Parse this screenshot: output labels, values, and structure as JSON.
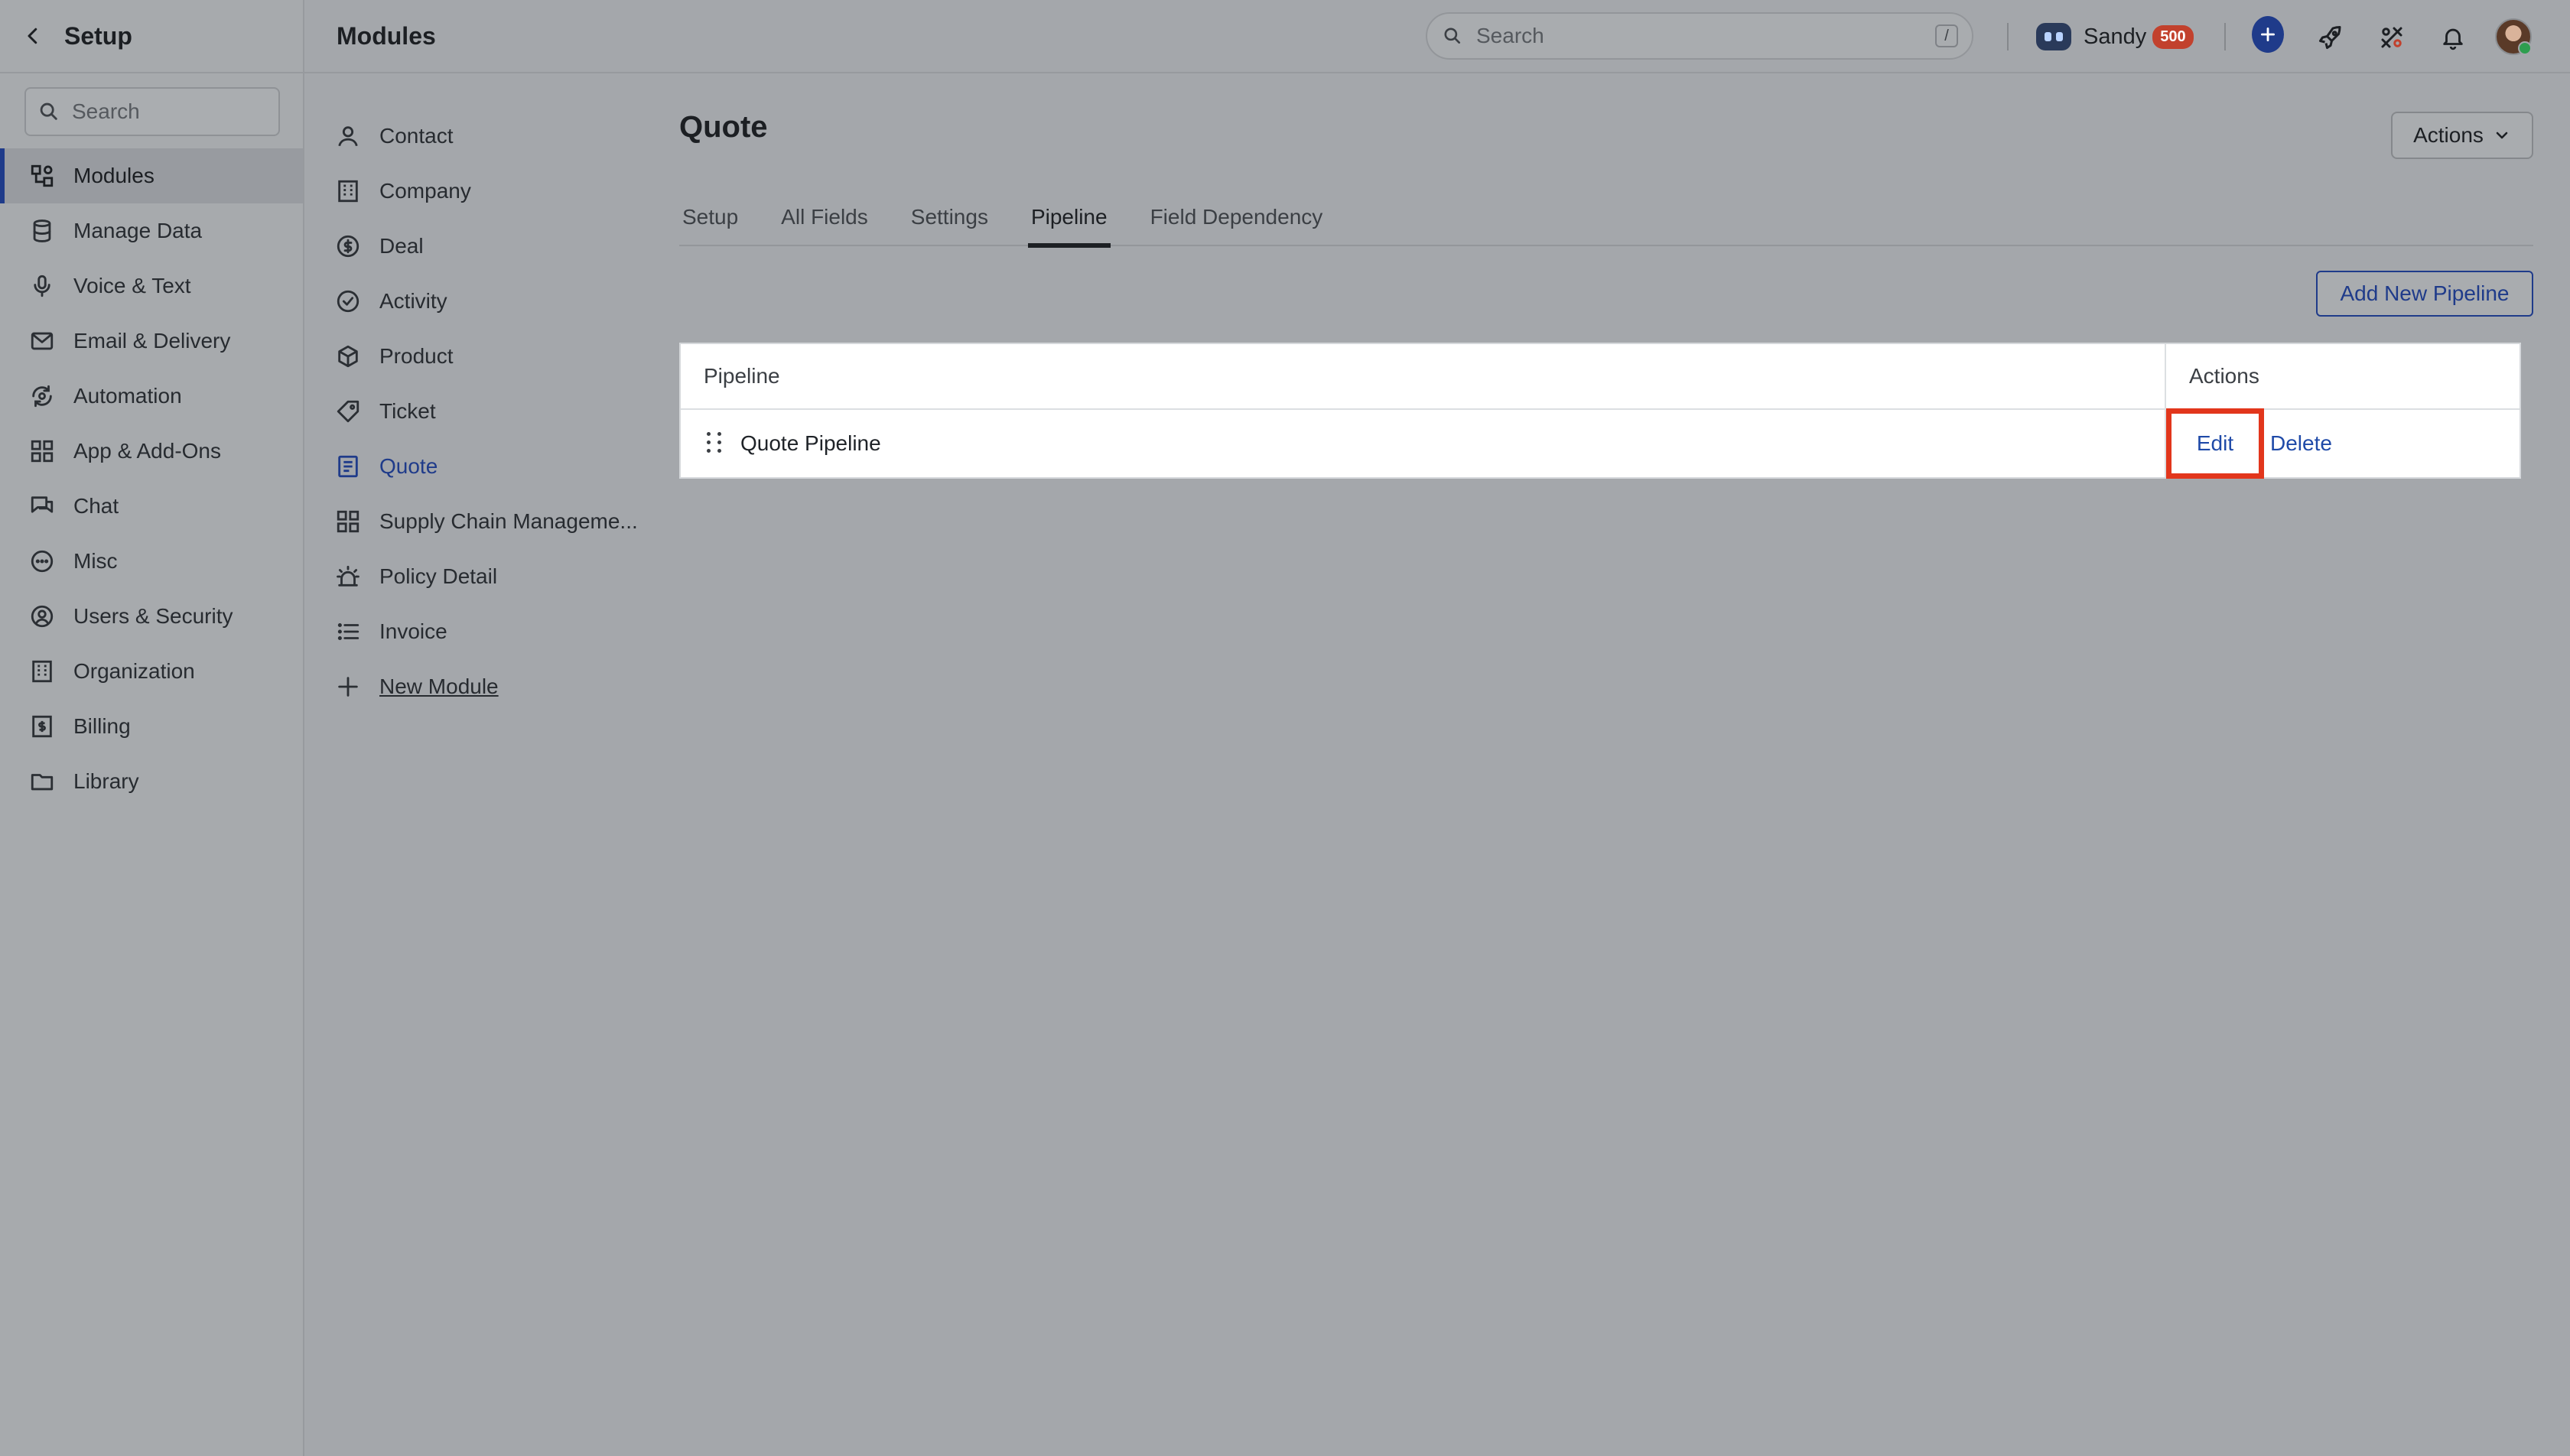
{
  "sidebar": {
    "title": "Setup",
    "search_placeholder": "Search",
    "items": [
      {
        "label": "Modules"
      },
      {
        "label": "Manage Data"
      },
      {
        "label": "Voice & Text"
      },
      {
        "label": "Email & Delivery"
      },
      {
        "label": "Automation"
      },
      {
        "label": "App & Add-Ons"
      },
      {
        "label": "Chat"
      },
      {
        "label": "Misc"
      },
      {
        "label": "Users & Security"
      },
      {
        "label": "Organization"
      },
      {
        "label": "Billing"
      },
      {
        "label": "Library"
      }
    ],
    "active_index": 0
  },
  "header": {
    "breadcrumb": "Modules",
    "search_placeholder": "Search",
    "search_shortcut": "/",
    "user_name": "Sandy",
    "badge_count": "500"
  },
  "modules": {
    "items": [
      {
        "label": "Contact"
      },
      {
        "label": "Company"
      },
      {
        "label": "Deal"
      },
      {
        "label": "Activity"
      },
      {
        "label": "Product"
      },
      {
        "label": "Ticket"
      },
      {
        "label": "Quote"
      },
      {
        "label": "Supply Chain Manageme..."
      },
      {
        "label": "Policy Detail"
      },
      {
        "label": "Invoice"
      }
    ],
    "new_module_label": "New Module",
    "active": "Quote"
  },
  "main": {
    "title": "Quote",
    "actions_label": "Actions",
    "tabs": [
      {
        "label": "Setup"
      },
      {
        "label": "All Fields"
      },
      {
        "label": "Settings"
      },
      {
        "label": "Pipeline"
      },
      {
        "label": "Field Dependency"
      }
    ],
    "active_tab": "Pipeline",
    "add_button_label": "Add New Pipeline",
    "table": {
      "headers": {
        "pipeline": "Pipeline",
        "actions": "Actions"
      },
      "rows": [
        {
          "name": "Quote Pipeline",
          "edit": "Edit",
          "delete": "Delete"
        }
      ]
    }
  },
  "colors": {
    "accent": "#1f3b8a",
    "highlight": "#e2361c",
    "badge": "#c2412d",
    "overlay_bg": "#a4a7ab"
  }
}
